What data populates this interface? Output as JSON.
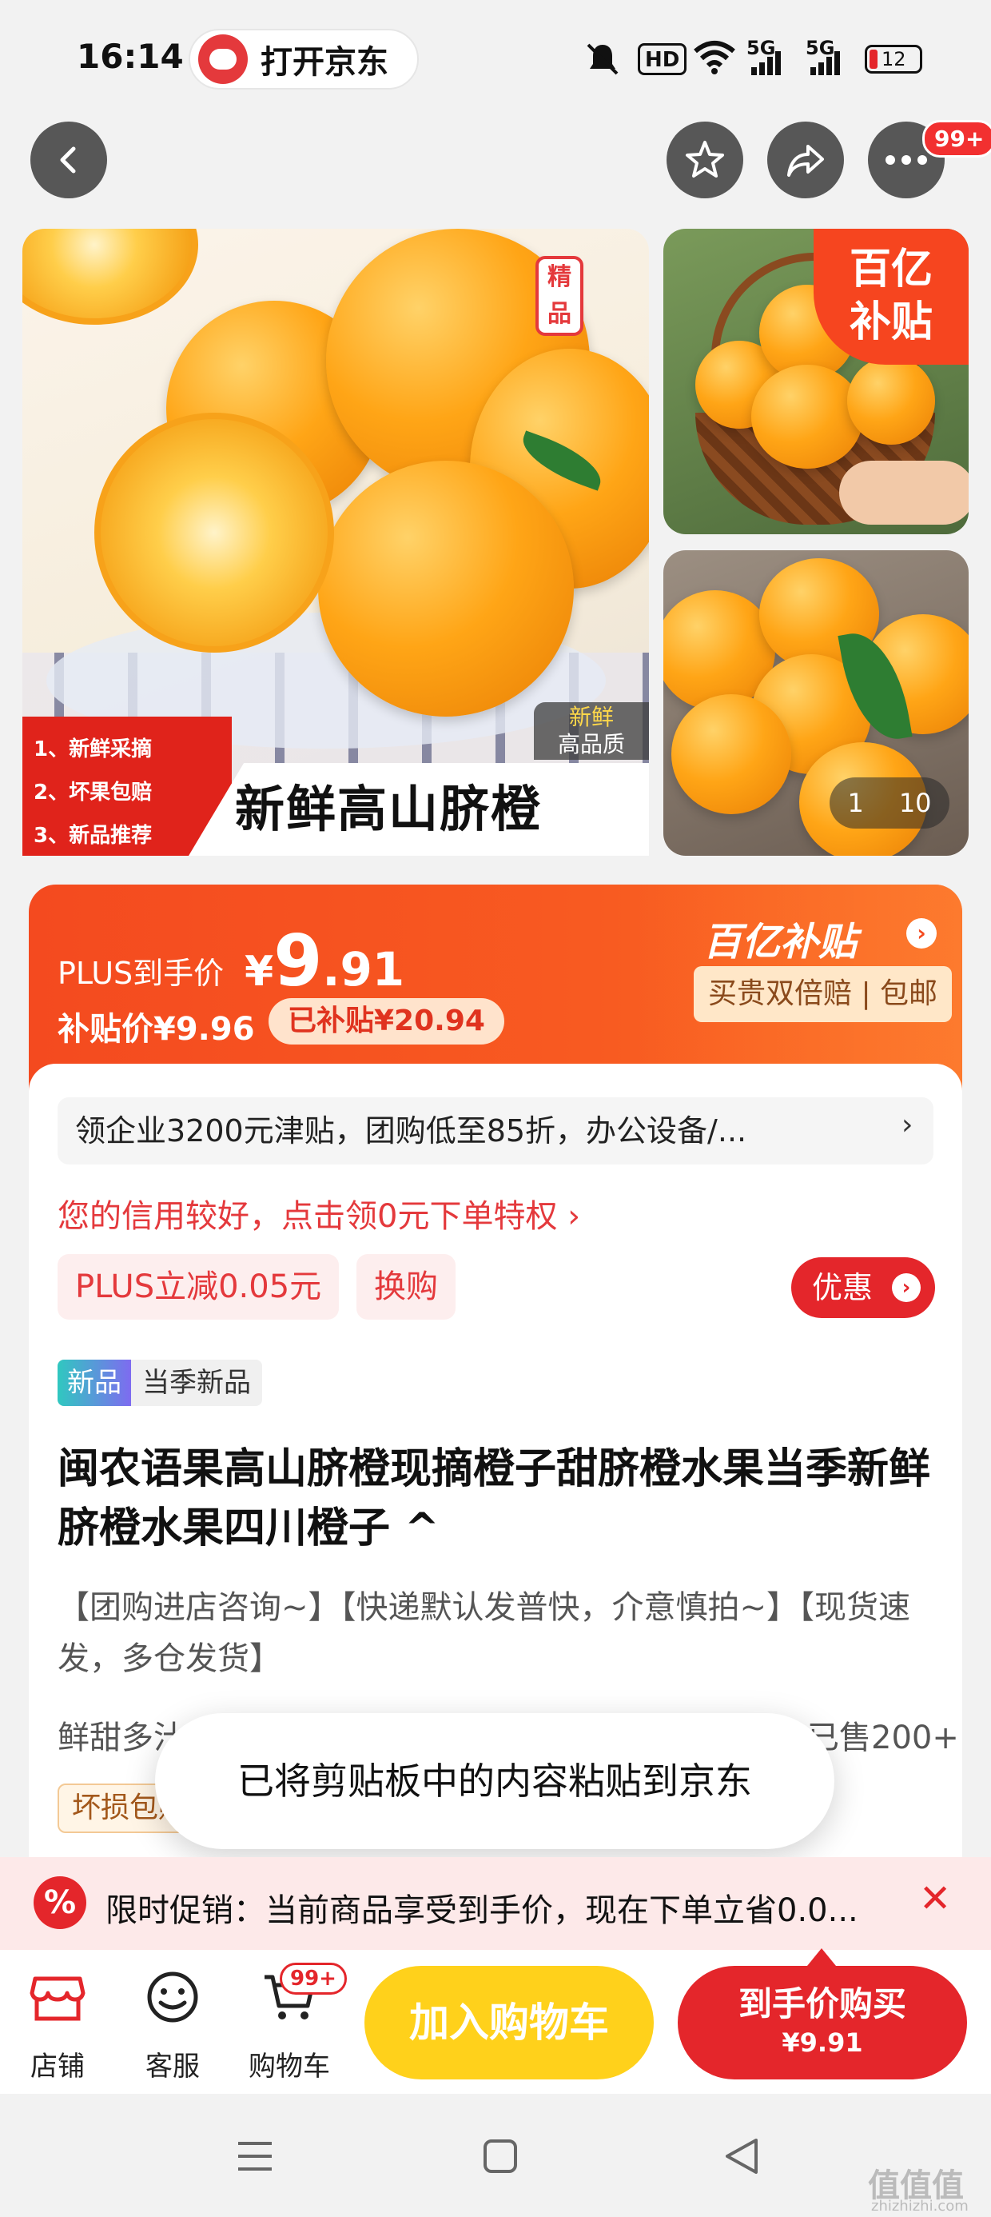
{
  "status_bar": {
    "time": "16:14",
    "open_app_label": "打开京东",
    "hd_label": "HD",
    "net1": "5G",
    "net2": "5G",
    "battery": "12"
  },
  "header": {
    "more_badge": "99+"
  },
  "gallery": {
    "main_tag_premium": "精品",
    "fresh_tag_line1": "新鲜",
    "fresh_tag_line2": "高品质",
    "bullets": [
      "1、新鲜采摘",
      "2、坏果包赔",
      "3、新品推荐"
    ],
    "banner_text": "新鲜高山脐橙",
    "subsidy_line1": "百亿",
    "subsidy_line2": "补贴",
    "counter_current": "1",
    "counter_total": "10"
  },
  "price": {
    "plus_label": "PLUS到手价",
    "currency": "¥",
    "integer": "9",
    "decimal": ".91",
    "subsidy_price_label": "补贴价¥9.96",
    "subsidized_label": "已补贴¥20.94",
    "brand_label": "百亿补贴",
    "guarantee_label": "买贵双倍赔 | 包邮"
  },
  "promos": {
    "enterprise_line": "领企业3200元津贴，团购低至85折，办公设备/...",
    "credit_line": "您的信用较好，点击领0元下单特权 ›",
    "plus_chip": "PLUS立减0.05元",
    "swap_chip": "换购",
    "discount_button": "优惠"
  },
  "product": {
    "new_badge": "新品",
    "new_badge_text": "当季新品",
    "title": "闽农语果高山脐橙现摘橙子甜脐橙水果当季新鲜脐橙水果四川橙子 ^",
    "description": "【团购进店咨询~】【快递默认发普快，介意慎拍~】【现货速发，多仓发货】",
    "feature_partial": "鲜甜多汁",
    "sold_partial": "已售200+",
    "damage_chip": "坏损包赔"
  },
  "toast": {
    "message": "已将剪贴板中的内容粘贴到京东"
  },
  "promo_bar": {
    "icon": "%",
    "text": "限时促销：当前商品享受到手价，现在下单立省0.0...",
    "close": "✕"
  },
  "bottom_nav": {
    "shop_label": "店铺",
    "service_label": "客服",
    "cart_label": "购物车",
    "cart_badge": "99+",
    "add_to_cart": "加入购物车",
    "buy_line1": "到手价购买",
    "buy_line2": "¥9.91"
  },
  "watermark": {
    "text": "值值值",
    "url": "zhizhizhi.com"
  },
  "colors": {
    "jd_red": "#e4262b",
    "subsidy_orange": "#f44a1f",
    "cart_yellow": "#ffd11b"
  }
}
